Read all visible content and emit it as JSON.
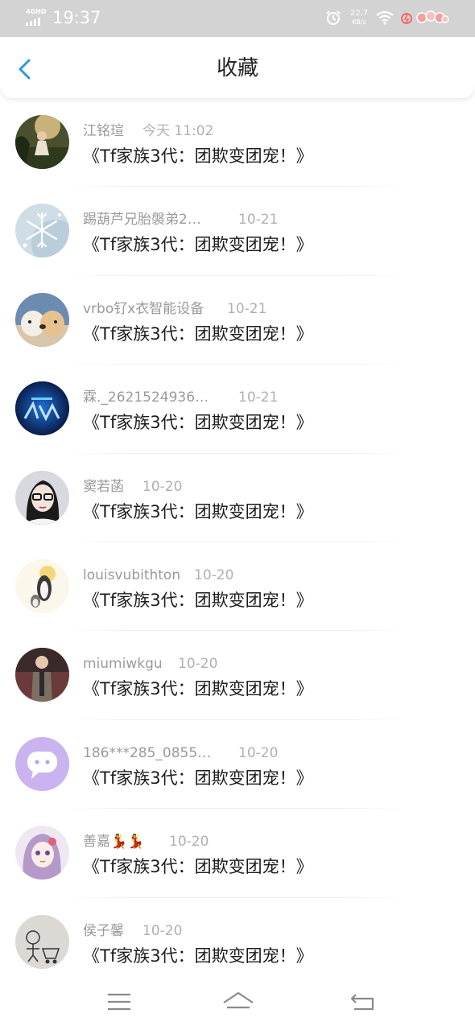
{
  "status_bar": {
    "network": "4GHD",
    "time": "19:37",
    "speed_value": "22.7",
    "speed_unit": "KB/s",
    "icons": [
      "signal-icon",
      "alarm-icon",
      "wifi-icon",
      "data-saver-icon",
      "battery-icon"
    ]
  },
  "header": {
    "title": "收藏",
    "back_icon": "chevron-left-icon"
  },
  "colors": {
    "accent": "#2b9bd9",
    "status_bar_bg": "#d3d3d3",
    "name_text": "#9a9a9a",
    "date_text": "#b0b0b0",
    "title_text": "#1c1c1c"
  },
  "items": [
    {
      "name": "江铭瑄",
      "date": "今天 11:02",
      "title": "《Tf家族3代：团欺变团宠！》",
      "avatar": "forest-girl"
    },
    {
      "name": "踢葫芦兄胎褩弟2…",
      "date": "10-21",
      "title": "《Tf家族3代：团欺变团宠！》",
      "avatar": "snowflake"
    },
    {
      "name": "vrbo钌x衣智能设备",
      "date": "10-21",
      "title": "《Tf家族3代：团欺变团宠！》",
      "avatar": "puppies"
    },
    {
      "name": "霖._2621524936…",
      "date": "10-21",
      "title": "《Tf家族3代：团欺变团宠！》",
      "avatar": "blue-logo"
    },
    {
      "name": "窦若菡",
      "date": "10-20",
      "title": "《Tf家族3代：团欺变团宠！》",
      "avatar": "glasses-girl"
    },
    {
      "name": "louisvubithton",
      "date": "10-20",
      "title": "《Tf家族3代：团欺变团宠！》",
      "avatar": "penguins"
    },
    {
      "name": "miumiwkgu",
      "date": "10-20",
      "title": "《Tf家族3代：团欺变团宠！》",
      "avatar": "man-coat"
    },
    {
      "name": "186***285_0855…",
      "date": "10-20",
      "title": "《Tf家族3代：团欺变团宠！》",
      "avatar": "chat-bubble"
    },
    {
      "name": "善嘉💃💃",
      "date": "10-20",
      "title": "《Tf家族3代：团欺变团宠！》",
      "avatar": "anime-girl"
    },
    {
      "name": "侯子馨",
      "date": "10-20",
      "title": "《Tf家族3代：团欺变团宠！》",
      "avatar": "sketch-cart"
    }
  ],
  "bottom_nav": {
    "icons": [
      "menu-icon",
      "home-icon",
      "back-icon"
    ]
  }
}
